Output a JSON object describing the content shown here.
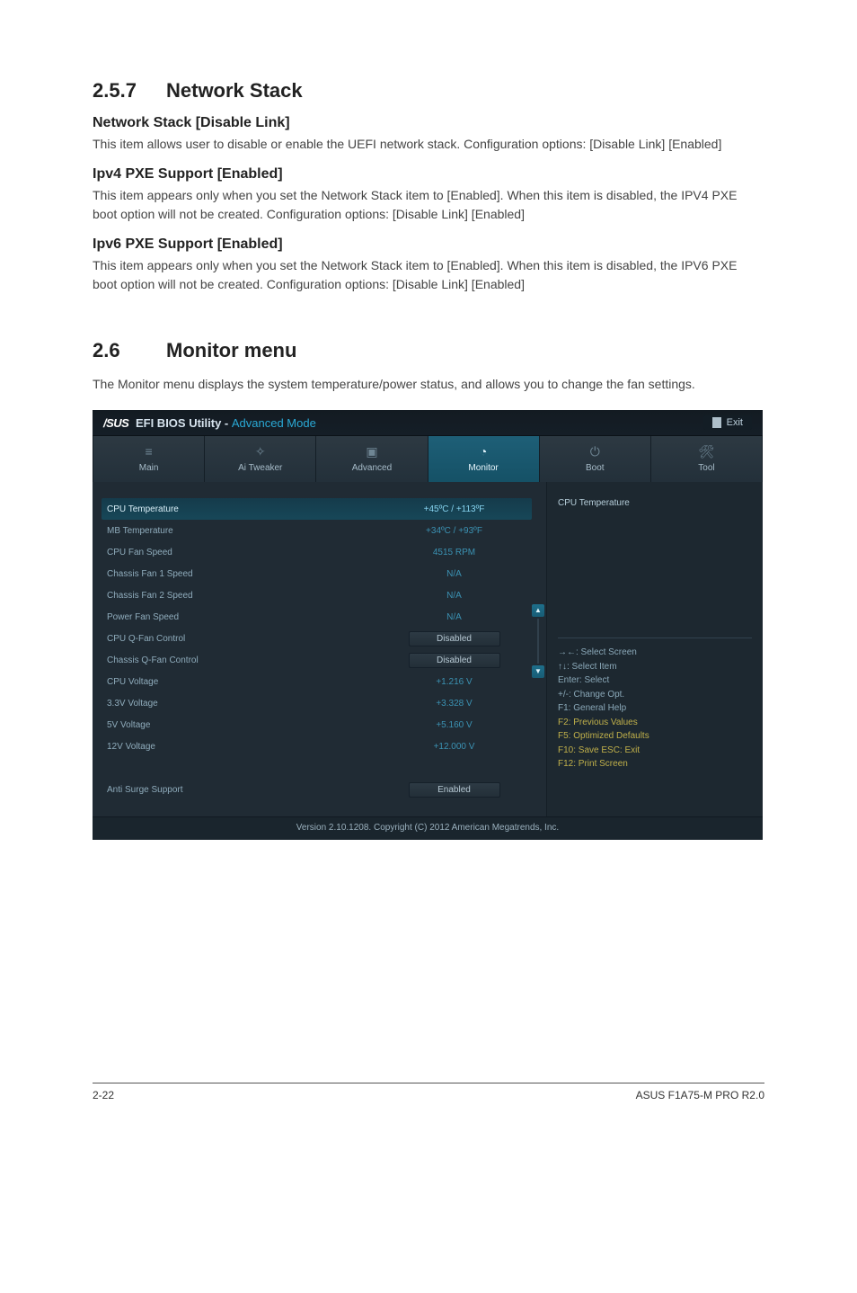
{
  "doc": {
    "section_257": {
      "heading_num": "2.5.7",
      "heading_title": "Network Stack",
      "items": [
        {
          "title": "Network Stack [Disable Link]",
          "body": "This item allows user to disable or enable the UEFI network stack. Configuration options: [Disable Link] [Enabled]"
        },
        {
          "title": "Ipv4 PXE Support [Enabled]",
          "body": "This item appears only when you set the Network Stack item to [Enabled]. When this item is disabled, the IPV4 PXE boot option will not be created. Configuration options: [Disable Link] [Enabled]"
        },
        {
          "title": "Ipv6 PXE Support [Enabled]",
          "body": "This item appears only when you set the Network Stack item to [Enabled]. When this item is disabled, the IPV6 PXE boot option will not be created. Configuration options: [Disable Link] [Enabled]"
        }
      ]
    },
    "section_26": {
      "heading_num": "2.6",
      "heading_title": "Monitor menu",
      "intro": "The Monitor menu displays the system temperature/power status, and allows you to change the fan settings."
    },
    "footer": {
      "page": "2-22",
      "product": "ASUS F1A75-M PRO R2.0"
    }
  },
  "bios": {
    "title_brand": "/SUS",
    "title_rest_a": "EFI BIOS Utility - ",
    "title_rest_b": "Advanced Mode",
    "exit_label": "Exit",
    "tabs": [
      {
        "label": "Main",
        "icon": "list-icon"
      },
      {
        "label": "Ai Tweaker",
        "icon": "tweak-icon"
      },
      {
        "label": "Advanced",
        "icon": "chip-icon"
      },
      {
        "label": "Monitor",
        "icon": "gauge-icon",
        "active": true
      },
      {
        "label": "Boot",
        "icon": "power-icon"
      },
      {
        "label": "Tool",
        "icon": "tool-icon"
      }
    ],
    "rows": [
      {
        "label": "CPU Temperature",
        "value": "+45ºC / +113ºF",
        "type": "text",
        "selected": true
      },
      {
        "label": "MB Temperature",
        "value": "+34ºC / +93ºF",
        "type": "text"
      },
      {
        "label": "CPU Fan Speed",
        "value": "4515 RPM",
        "type": "text"
      },
      {
        "label": "Chassis Fan 1 Speed",
        "value": "N/A",
        "type": "text"
      },
      {
        "label": "Chassis Fan 2 Speed",
        "value": "N/A",
        "type": "text"
      },
      {
        "label": "Power Fan Speed",
        "value": "N/A",
        "type": "text"
      },
      {
        "label": "CPU Q-Fan Control",
        "value": "Disabled",
        "type": "button"
      },
      {
        "label": "Chassis Q-Fan Control",
        "value": "Disabled",
        "type": "button"
      },
      {
        "label": "CPU Voltage",
        "value": "+1.216 V",
        "type": "text"
      },
      {
        "label": "3.3V Voltage",
        "value": "+3.328 V",
        "type": "text"
      },
      {
        "label": "5V Voltage",
        "value": "+5.160 V",
        "type": "text"
      },
      {
        "label": "12V Voltage",
        "value": "+12.000 V",
        "type": "text"
      },
      {
        "label": "",
        "value": "",
        "type": "spacer"
      },
      {
        "label": "Anti Surge Support",
        "value": "Enabled",
        "type": "button"
      }
    ],
    "info_title": "CPU Temperature",
    "help": [
      {
        "text": "→←: Select Screen",
        "hl": false
      },
      {
        "text": "↑↓: Select Item",
        "hl": false
      },
      {
        "text": "Enter: Select",
        "hl": false
      },
      {
        "text": "+/-: Change Opt.",
        "hl": false
      },
      {
        "text": "F1: General Help",
        "hl": false
      },
      {
        "text": "F2: Previous Values",
        "hl": true
      },
      {
        "text": "F5: Optimized Defaults",
        "hl": true
      },
      {
        "text": "F10: Save   ESC: Exit",
        "hl": true
      },
      {
        "text": "F12: Print Screen",
        "hl": true
      }
    ],
    "footer": "Version 2.10.1208.  Copyright (C) 2012 American Megatrends, Inc."
  }
}
